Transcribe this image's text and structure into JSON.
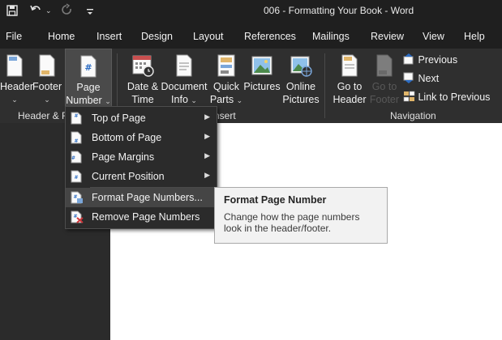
{
  "titlebar": {
    "title": "006 - Formatting Your Book  -  Word"
  },
  "tabs": [
    "File",
    "Home",
    "Insert",
    "Design",
    "Layout",
    "References",
    "Mailings",
    "Review",
    "View",
    "Help"
  ],
  "ribbon": {
    "header_footer": {
      "header_label": "Header",
      "footer_label": "Footer",
      "page_number_line1": "Page",
      "page_number_line2": "Number",
      "group_label": "Header & F"
    },
    "insert": {
      "date_time_line1": "Date &",
      "date_time_line2": "Time",
      "doc_info_line1": "Document",
      "doc_info_line2": "Info",
      "quick_parts_line1": "Quick",
      "quick_parts_line2": "Parts",
      "pictures_label": "Pictures",
      "online_pictures_line1": "Online",
      "online_pictures_line2": "Pictures",
      "group_label": "nsert"
    },
    "navigation": {
      "goto_header_line1": "Go to",
      "goto_header_line2": "Header",
      "goto_footer_line1": "Go to",
      "goto_footer_line2": "Footer",
      "previous_label": "Previous",
      "next_label": "Next",
      "link_label": "Link to Previous",
      "group_label": "Navigation"
    }
  },
  "menu": {
    "items": [
      {
        "label": "Top of Page",
        "icon": "page-top-icon",
        "submenu": true
      },
      {
        "label": "Bottom of Page",
        "icon": "page-bottom-icon",
        "submenu": true
      },
      {
        "label": "Page Margins",
        "icon": "page-margins-icon",
        "submenu": true
      },
      {
        "label": "Current Position",
        "icon": "current-position-icon",
        "submenu": true
      },
      {
        "label": "Format Page Numbers...",
        "icon": "format-page-numbers-icon",
        "submenu": false
      },
      {
        "label": "Remove Page Numbers",
        "icon": "remove-page-numbers-icon",
        "submenu": false
      }
    ]
  },
  "tooltip": {
    "title": "Format Page Number",
    "body": "Change how the page numbers look in the header/footer."
  },
  "colors": {
    "ribbon_bg": "#2f2f2f",
    "titlebar_bg": "#1f1f1f",
    "accent_blue": "#2b6cc4",
    "remove_red": "#d13438"
  }
}
